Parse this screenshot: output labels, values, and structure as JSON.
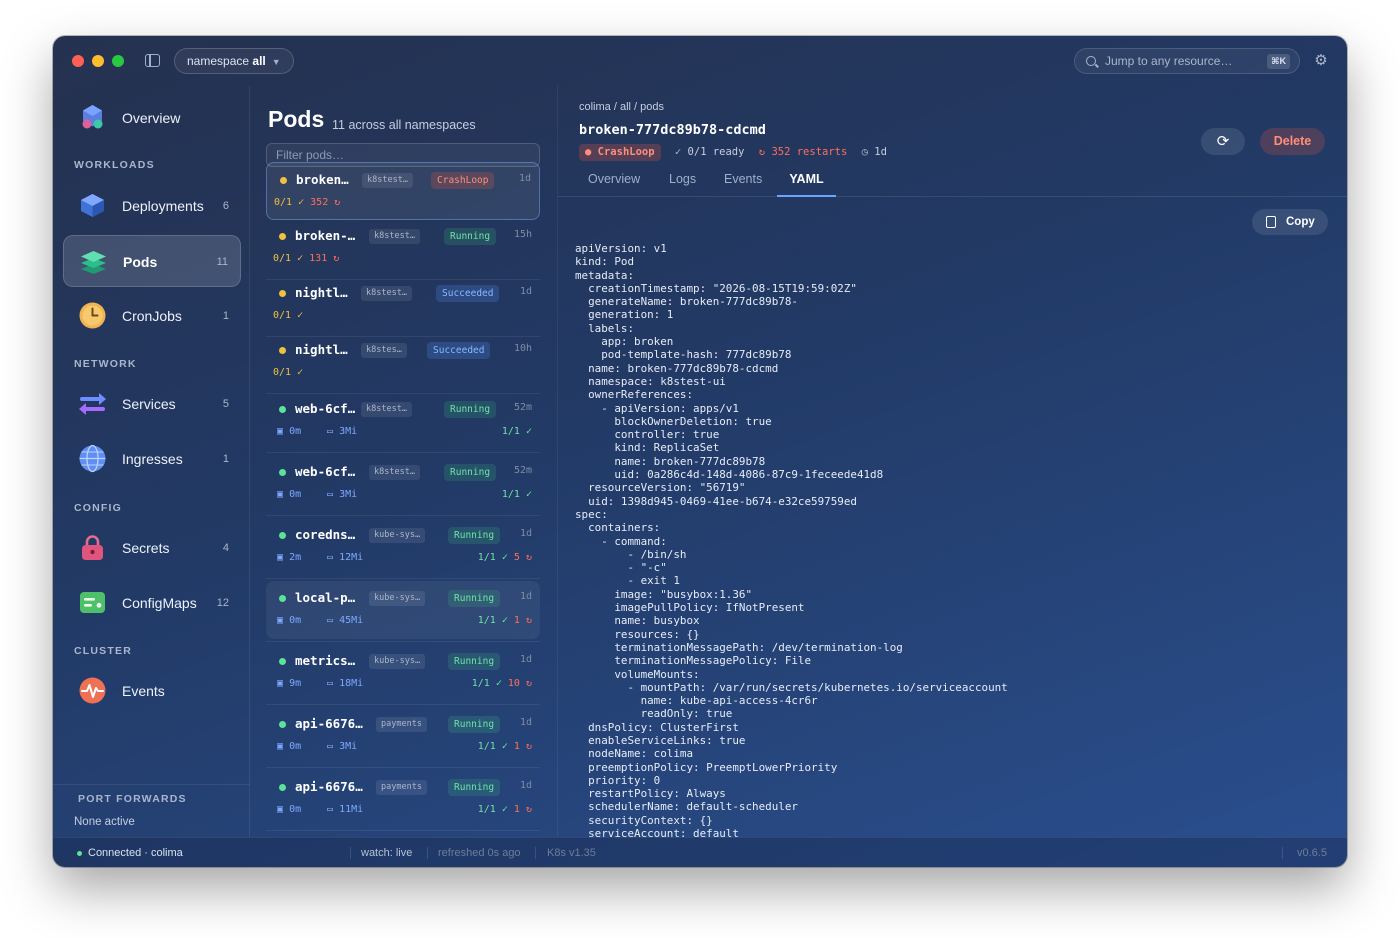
{
  "titlebar": {
    "namespace_prefix": "namespace",
    "namespace_value": "all",
    "jump_placeholder": "Jump to any resource…",
    "jump_shortcut": "⌘K"
  },
  "sidebar": {
    "overview": "Overview",
    "sections": {
      "workloads": "WORKLOADS",
      "network": "NETWORK",
      "config": "CONFIG",
      "cluster": "CLUSTER"
    },
    "items": [
      {
        "label": "Deployments",
        "count": "6"
      },
      {
        "label": "Pods",
        "count": "11"
      },
      {
        "label": "CronJobs",
        "count": "1"
      },
      {
        "label": "Services",
        "count": "5"
      },
      {
        "label": "Ingresses",
        "count": "1"
      },
      {
        "label": "Secrets",
        "count": "4"
      },
      {
        "label": "ConfigMaps",
        "count": "12"
      },
      {
        "label": "Events",
        "count": ""
      }
    ],
    "port_forwards_title": "PORT FORWARDS",
    "port_forwards_status": "None active"
  },
  "pods": {
    "title": "Pods",
    "subtitle": "11 across all namespaces",
    "filter_placeholder": "Filter pods…",
    "list": [
      {
        "name": "broken…",
        "ns": "k8stest…",
        "status": "CrashLoop",
        "age": "1d",
        "ready": "0/1",
        "restarts": "352"
      },
      {
        "name": "broken-…",
        "ns": "k8stest…",
        "status": "Running",
        "age": "15h",
        "ready": "0/1",
        "restarts": "131"
      },
      {
        "name": "nightl…",
        "ns": "k8stest…",
        "status": "Succeeded",
        "age": "1d",
        "ready": "0/1",
        "restarts": ""
      },
      {
        "name": "nightl…",
        "ns": "k8stes…",
        "status": "Succeeded",
        "age": "10h",
        "ready": "0/1",
        "restarts": ""
      },
      {
        "name": "web-6cf…",
        "ns": "k8stest…",
        "status": "Running",
        "age": "52m",
        "cpu": "0m",
        "mem": "3Mi",
        "ready": "1/1",
        "restarts": ""
      },
      {
        "name": "web-6cf…",
        "ns": "k8stest…",
        "status": "Running",
        "age": "52m",
        "cpu": "0m",
        "mem": "3Mi",
        "ready": "1/1",
        "restarts": ""
      },
      {
        "name": "coredns…",
        "ns": "kube-sys…",
        "status": "Running",
        "age": "1d",
        "cpu": "2m",
        "mem": "12Mi",
        "ready": "1/1",
        "restarts": "5"
      },
      {
        "name": "local-p…",
        "ns": "kube-sys…",
        "status": "Running",
        "age": "1d",
        "cpu": "0m",
        "mem": "45Mi",
        "ready": "1/1",
        "restarts": "1"
      },
      {
        "name": "metrics…",
        "ns": "kube-sys…",
        "status": "Running",
        "age": "1d",
        "cpu": "9m",
        "mem": "18Mi",
        "ready": "1/1",
        "restarts": "10"
      },
      {
        "name": "api-6676…",
        "ns": "payments",
        "status": "Running",
        "age": "1d",
        "cpu": "0m",
        "mem": "3Mi",
        "ready": "1/1",
        "restarts": "1"
      },
      {
        "name": "api-6676…",
        "ns": "payments",
        "status": "Running",
        "age": "1d",
        "cpu": "0m",
        "mem": "11Mi",
        "ready": "1/1",
        "restarts": "1"
      }
    ]
  },
  "detail": {
    "breadcrumb": "colima / all / pods",
    "title": "broken-777dc89b78-cdcmd",
    "status_chip": "CrashLoop",
    "ready": "0/1 ready",
    "restarts": "352 restarts",
    "age": "1d",
    "delete_label": "Delete",
    "copy_label": "Copy",
    "tabs": [
      "Overview",
      "Logs",
      "Events",
      "YAML"
    ],
    "yaml": "apiVersion: v1\nkind: Pod\nmetadata:\n  creationTimestamp: \"2026-08-15T19:59:02Z\"\n  generateName: broken-777dc89b78-\n  generation: 1\n  labels:\n    app: broken\n    pod-template-hash: 777dc89b78\n  name: broken-777dc89b78-cdcmd\n  namespace: k8stest-ui\n  ownerReferences:\n    - apiVersion: apps/v1\n      blockOwnerDeletion: true\n      controller: true\n      kind: ReplicaSet\n      name: broken-777dc89b78\n      uid: 0a286c4d-148d-4086-87c9-1feceede41d8\n  resourceVersion: \"56719\"\n  uid: 1398d945-0469-41ee-b674-e32ce59759ed\nspec:\n  containers:\n    - command:\n        - /bin/sh\n        - \"-c\"\n        - exit 1\n      image: \"busybox:1.36\"\n      imagePullPolicy: IfNotPresent\n      name: busybox\n      resources: {}\n      terminationMessagePath: /dev/termination-log\n      terminationMessagePolicy: File\n      volumeMounts:\n        - mountPath: /var/run/secrets/kubernetes.io/serviceaccount\n          name: kube-api-access-4cr6r\n          readOnly: true\n  dnsPolicy: ClusterFirst\n  enableServiceLinks: true\n  nodeName: colima\n  preemptionPolicy: PreemptLowerPriority\n  priority: 0\n  restartPolicy: Always\n  schedulerName: default-scheduler\n  securityContext: {}\n  serviceAccount: default"
  },
  "statusbar": {
    "connection": "Connected · colima",
    "watch": "watch: live",
    "refreshed": "refreshed 0s ago",
    "k8s": "K8s v1.35",
    "version": "v0.6.5"
  },
  "colors": {
    "crash": "#ff8f78",
    "running": "#6fe3a4",
    "succeeded": "#8ab8ff",
    "accent": "#6aa6ff"
  }
}
